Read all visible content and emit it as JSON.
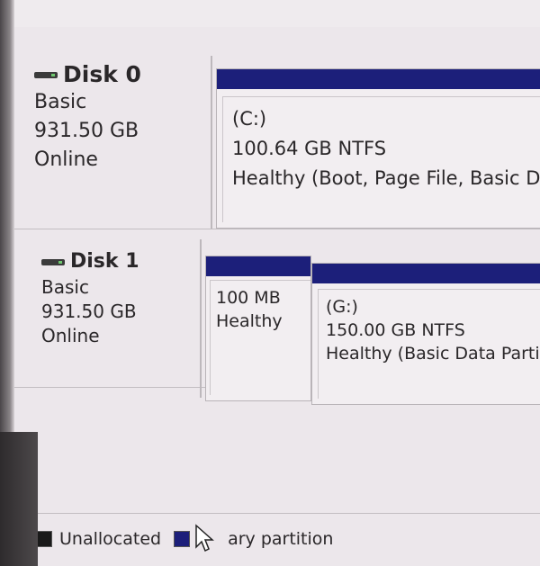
{
  "disks": [
    {
      "name": "Disk 0",
      "type": "Basic",
      "size": "931.50 GB",
      "status": "Online",
      "partitions": [
        {
          "letter": "(C:)",
          "size_fs": "100.64 GB NTFS",
          "status": "Healthy (Boot, Page File, Basic Da"
        }
      ]
    },
    {
      "name": "Disk 1",
      "type": "Basic",
      "size": "931.50 GB",
      "status": "Online",
      "partitions": [
        {
          "letter": "",
          "size_fs": "100 MB",
          "status": "Healthy"
        },
        {
          "letter": "(G:)",
          "size_fs": "150.00 GB NTFS",
          "status": "Healthy (Basic Data Partit"
        }
      ]
    }
  ],
  "legend": [
    {
      "label": "Unallocated",
      "color": "#1a1a1a"
    },
    {
      "label": "ary partition",
      "color": "#1c1f7a"
    }
  ],
  "colors": {
    "partition_bar": "#1c1f7a"
  }
}
